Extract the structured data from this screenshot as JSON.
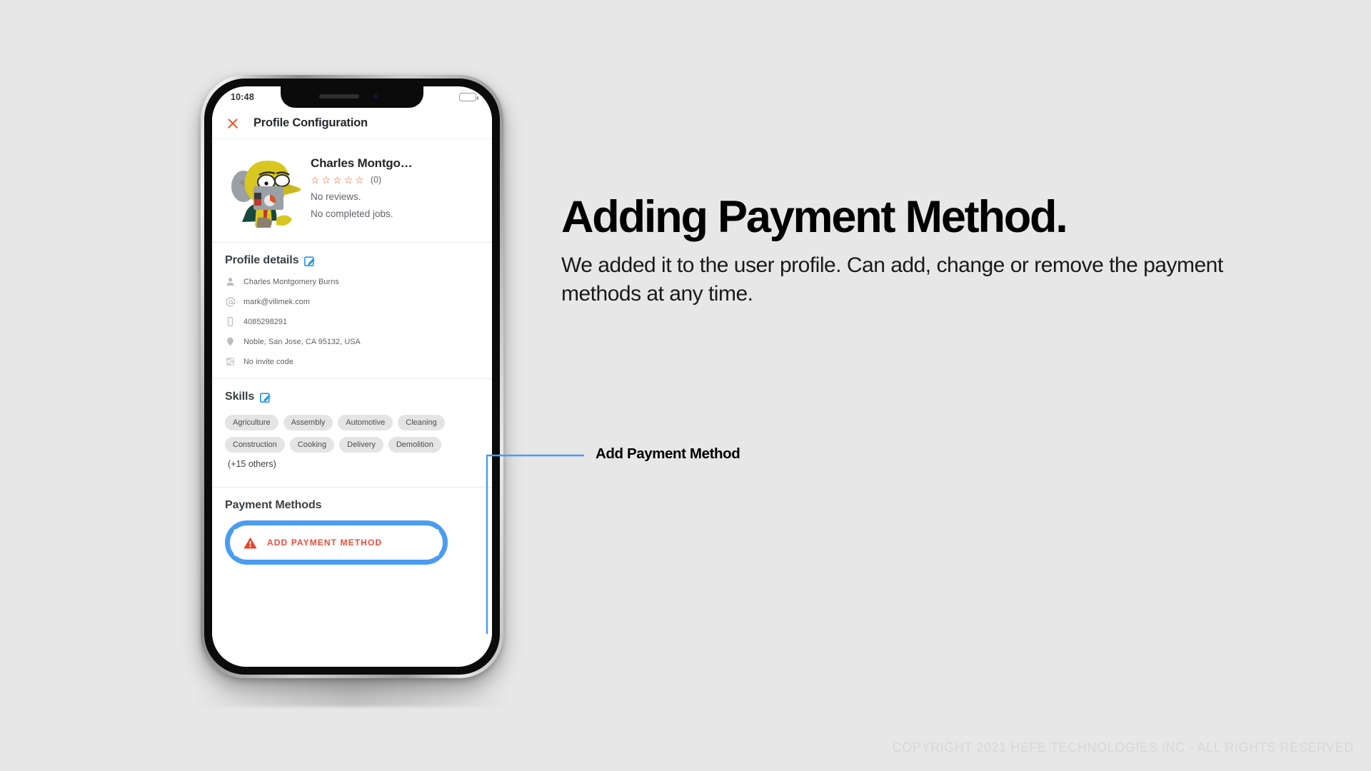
{
  "page": {
    "background_color": "#e7e7e7",
    "headline": "Adding Payment Method.",
    "subhead": "We added it to the user profile. Can add, change or remove the payment methods at any time.",
    "copyright": "COPYRIGHT 2021 HEFE TECHNOLOGIES INC - ALL RIGHTS RESERVED",
    "accent_blue": "#4a9cf0",
    "accent_red": "#ef4b3a"
  },
  "callout": {
    "label": "Add Payment Method",
    "line_color": "#4a9cf0"
  },
  "phone": {
    "status_bar": {
      "time": "10:48",
      "battery_icon": "battery-icon"
    },
    "app_bar": {
      "close_icon": "close-icon",
      "title": "Profile Configuration"
    },
    "profile": {
      "avatar_icon": "user-avatar-image",
      "avatar_camera_icon": "camera-icon",
      "name": "Charles Montgo…",
      "stars": [
        "☆",
        "☆",
        "☆",
        "☆",
        "☆"
      ],
      "rating_count": "(0)",
      "reviews_text": "No reviews.",
      "jobs_text": "No completed jobs."
    },
    "profile_details": {
      "title": "Profile details",
      "edit_icon": "edit-icon",
      "rows": [
        {
          "icon": "person-icon",
          "text": "Charles Montgomery Burns"
        },
        {
          "icon": "at-email-icon",
          "text": "mark@vilimek.com"
        },
        {
          "icon": "phone-icon",
          "text": "4085298291"
        },
        {
          "icon": "location-pin-icon",
          "text": "Noble, San Jose, CA 95132, USA"
        },
        {
          "icon": "share-icon",
          "text": "No invite code"
        }
      ]
    },
    "skills": {
      "title": "Skills",
      "edit_icon": "edit-icon",
      "chips": [
        "Agriculture",
        "Assembly",
        "Automotive",
        "Cleaning",
        "Construction",
        "Cooking",
        "Delivery",
        "Demolition"
      ],
      "more_label": "(+15 others)"
    },
    "payment": {
      "title": "Payment Methods",
      "add_button_label": "ADD PAYMENT METHOD",
      "warning_icon": "warning-triangle-icon",
      "highlight_color": "#4a9cf0"
    }
  }
}
